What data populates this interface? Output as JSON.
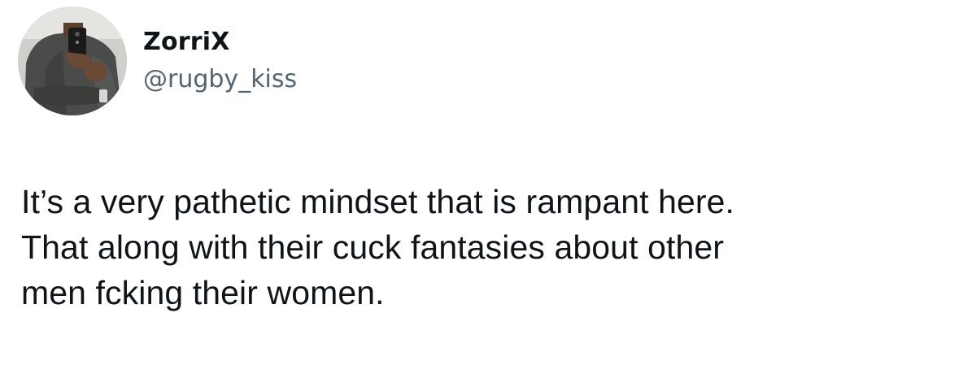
{
  "tweet": {
    "author": {
      "display_name": "ZorriX",
      "handle": "@rugby_kiss",
      "avatar_icon": "user-avatar-photo"
    },
    "text_lines": [
      "It’s a very pathetic mindset that is rampant here.",
      "That along with their cuck fantasies about other",
      "men fcking their women."
    ]
  },
  "colors": {
    "text_primary": "#0f1419",
    "text_secondary": "#536471",
    "background": "#ffffff"
  }
}
